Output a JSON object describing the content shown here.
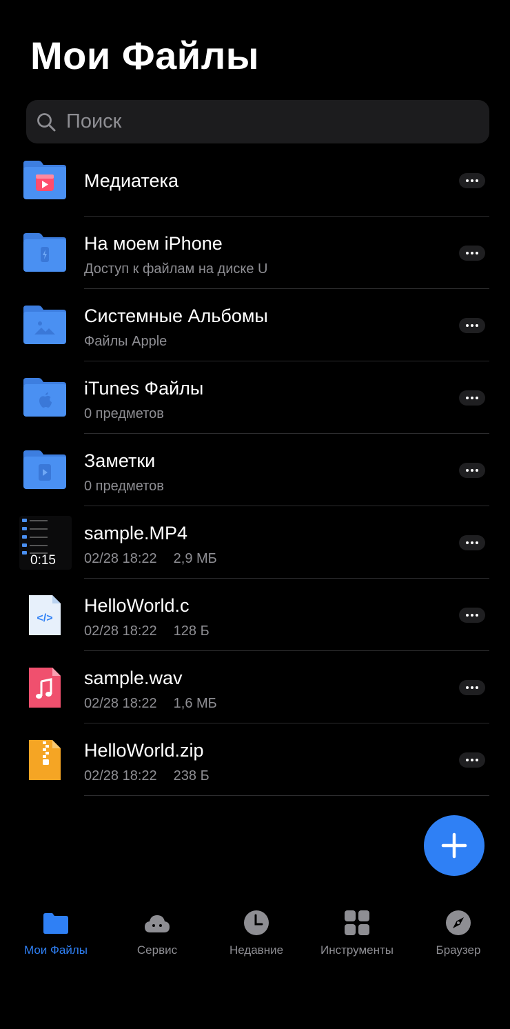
{
  "header": {
    "title": "Мои Файлы"
  },
  "search": {
    "placeholder": "Поиск"
  },
  "items": [
    {
      "name": "Медиатека",
      "sub": ""
    },
    {
      "name": "На моем iPhone",
      "sub": "Доступ к файлам на диске U"
    },
    {
      "name": "Системные Альбомы",
      "sub": "Файлы Apple"
    },
    {
      "name": "iTunes Файлы",
      "sub": " 0 предметов"
    },
    {
      "name": "Заметки",
      "sub": " 0 предметов"
    },
    {
      "name": "sample.MP4",
      "date": "02/28 18:22",
      "size": "2,9 МБ",
      "duration": "0:15"
    },
    {
      "name": "HelloWorld.c",
      "date": "02/28 18:22",
      "size": "128 Б"
    },
    {
      "name": "sample.wav",
      "date": "02/28 18:22",
      "size": "1,6 МБ"
    },
    {
      "name": "HelloWorld.zip",
      "date": "02/28 18:22",
      "size": "238 Б"
    }
  ],
  "tabs": [
    {
      "label": "Мои Файлы",
      "active": true
    },
    {
      "label": "Сервис"
    },
    {
      "label": "Недавние"
    },
    {
      "label": "Инструменты"
    },
    {
      "label": "Браузер"
    }
  ],
  "colors": {
    "accent": "#2f80f5",
    "background": "#000000",
    "folder": "#4a90f2"
  }
}
